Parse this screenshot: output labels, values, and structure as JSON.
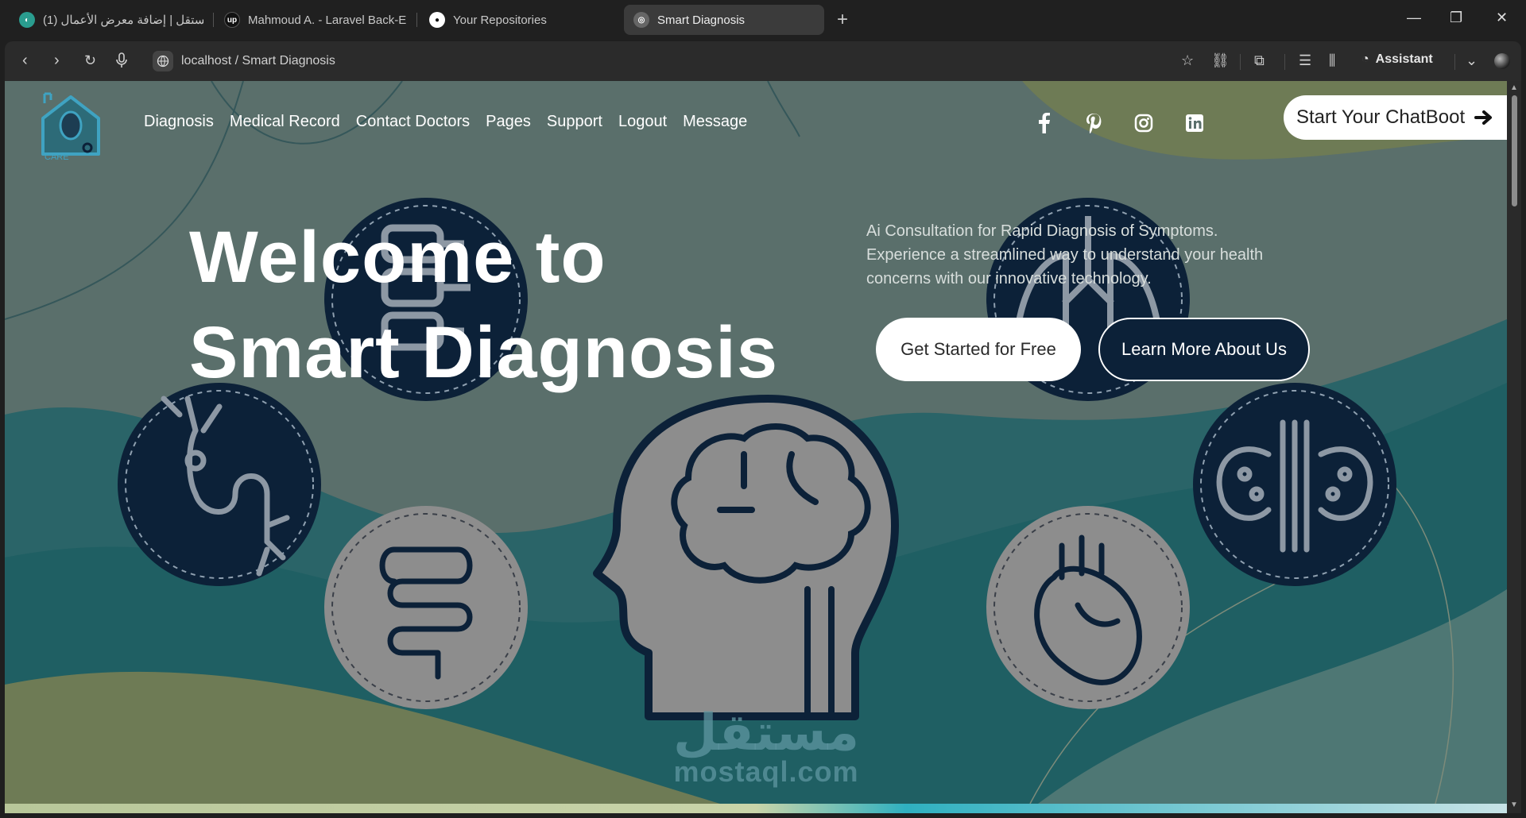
{
  "browser": {
    "tabs": [
      {
        "label": "مستقل | إضافة معرض الأعمال (1)",
        "icon": "mostaql-icon"
      },
      {
        "label": "Mahmoud A. - Laravel Back-E",
        "icon": "upwork-icon"
      },
      {
        "label": "Your Repositories",
        "icon": "github-icon"
      },
      {
        "label": "Smart Diagnosis",
        "icon": "globe-icon",
        "active": true
      }
    ],
    "address": "localhost / Smart Diagnosis",
    "assistant_label": "Assistant"
  },
  "site": {
    "nav": [
      "Diagnosis",
      "Medical Record",
      "Contact Doctors",
      "Pages",
      "Support",
      "Logout",
      "Message"
    ],
    "logo_text": "CARE",
    "social": [
      "facebook-icon",
      "pinterest-icon",
      "instagram-icon",
      "linkedin-icon"
    ],
    "chatboot_label": "Start Your ChatBoot",
    "hero": {
      "title_line1": "Welcome to",
      "title_line2": "Smart Diagnosis",
      "description": "Ai Consultation for Rapid Diagnosis of Symptoms. Experience a streamlined way to understand your health concerns with our innovative technology.",
      "cta_primary": "Get Started for Free",
      "cta_secondary": "Learn More About Us"
    },
    "organs": [
      "spine-icon",
      "nerve-icon",
      "intestine-icon",
      "brain-head-icon",
      "lungs-icon",
      "kidneys-icon",
      "heart-icon"
    ]
  },
  "watermark": {
    "arabic": "مستقل",
    "latin": "mostaql.com"
  },
  "colors": {
    "background": "#5a6f6b",
    "teal": "#1f5f63",
    "olive": "#6e7b55",
    "navy": "#0c2138",
    "grey_circle": "#8d8d8d"
  }
}
